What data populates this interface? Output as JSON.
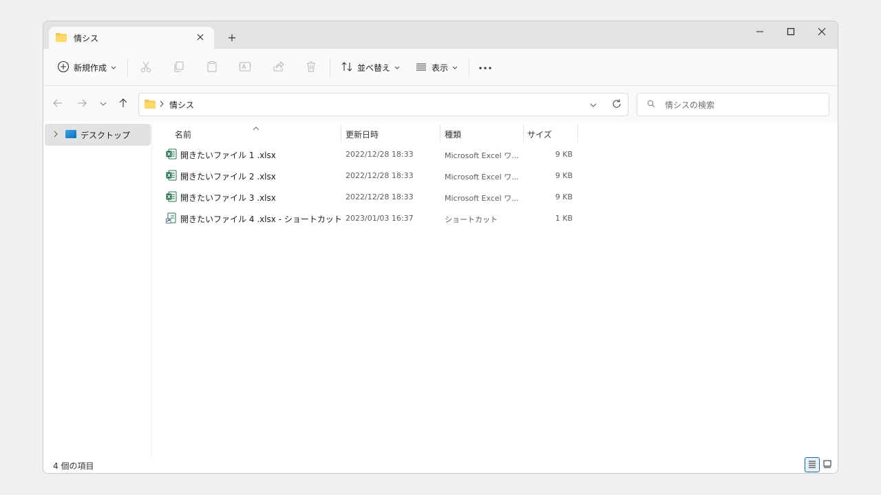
{
  "tab": {
    "title": "情シス"
  },
  "toolbar": {
    "new_label": "新規作成",
    "sort_label": "並べ替え",
    "view_label": "表示"
  },
  "address": {
    "crumb": "情シス"
  },
  "search": {
    "placeholder": "情シスの検索"
  },
  "sidebar": {
    "items": [
      {
        "label": "デスクトップ"
      }
    ]
  },
  "columns": {
    "name": "名前",
    "date": "更新日時",
    "type": "種類",
    "size": "サイズ"
  },
  "files": [
    {
      "name": "開きたいファイル 1 .xlsx",
      "date": "2022/12/28 18:33",
      "type": "Microsoft Excel ワ...",
      "size": "9 KB",
      "icon": "excel-file-icon"
    },
    {
      "name": "開きたいファイル 2 .xlsx",
      "date": "2022/12/28 18:33",
      "type": "Microsoft Excel ワ...",
      "size": "9 KB",
      "icon": "excel-file-icon"
    },
    {
      "name": "開きたいファイル 3 .xlsx",
      "date": "2022/12/28 18:33",
      "type": "Microsoft Excel ワ...",
      "size": "9 KB",
      "icon": "excel-file-icon"
    },
    {
      "name": "開きたいファイル 4 .xlsx - ショートカット",
      "date": "2023/01/03 16:37",
      "type": "ショートカット",
      "size": "1 KB",
      "icon": "shortcut-file-icon"
    }
  ],
  "status": {
    "count": "4 個の項目"
  },
  "colors": {
    "folder": "#f8c74a",
    "excel": "#1d7044",
    "accent": "#005fb8",
    "selected_bg": "#e2e2e2"
  }
}
